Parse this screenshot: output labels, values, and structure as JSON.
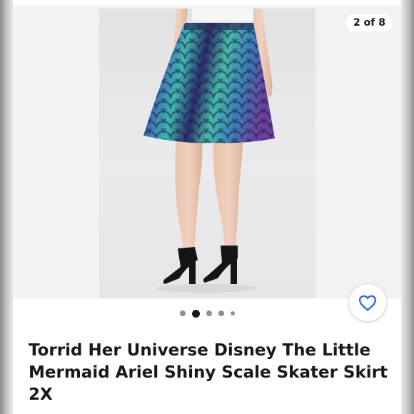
{
  "gallery": {
    "counter": "2 of 8",
    "current_index": 2,
    "total_images": 8,
    "photo_alt": "Iridescent mermaid scale skater skirt worn with black heels"
  },
  "pagination_dots": [
    {
      "state": "inactive"
    },
    {
      "state": "active"
    },
    {
      "state": "inactive"
    },
    {
      "state": "inactive"
    },
    {
      "state": "inactive-small"
    }
  ],
  "save_button": {
    "icon": "heart-icon",
    "color": "#3665f3"
  },
  "product": {
    "title": "Torrid Her Universe Disney The Little Mermaid Ariel Shiny Scale Skater Skirt 2X"
  },
  "colors": {
    "text": "#191919",
    "accent": "#3665f3",
    "skirt_teal": "#3fb6b0",
    "skirt_purple": "#5b3d9c"
  }
}
